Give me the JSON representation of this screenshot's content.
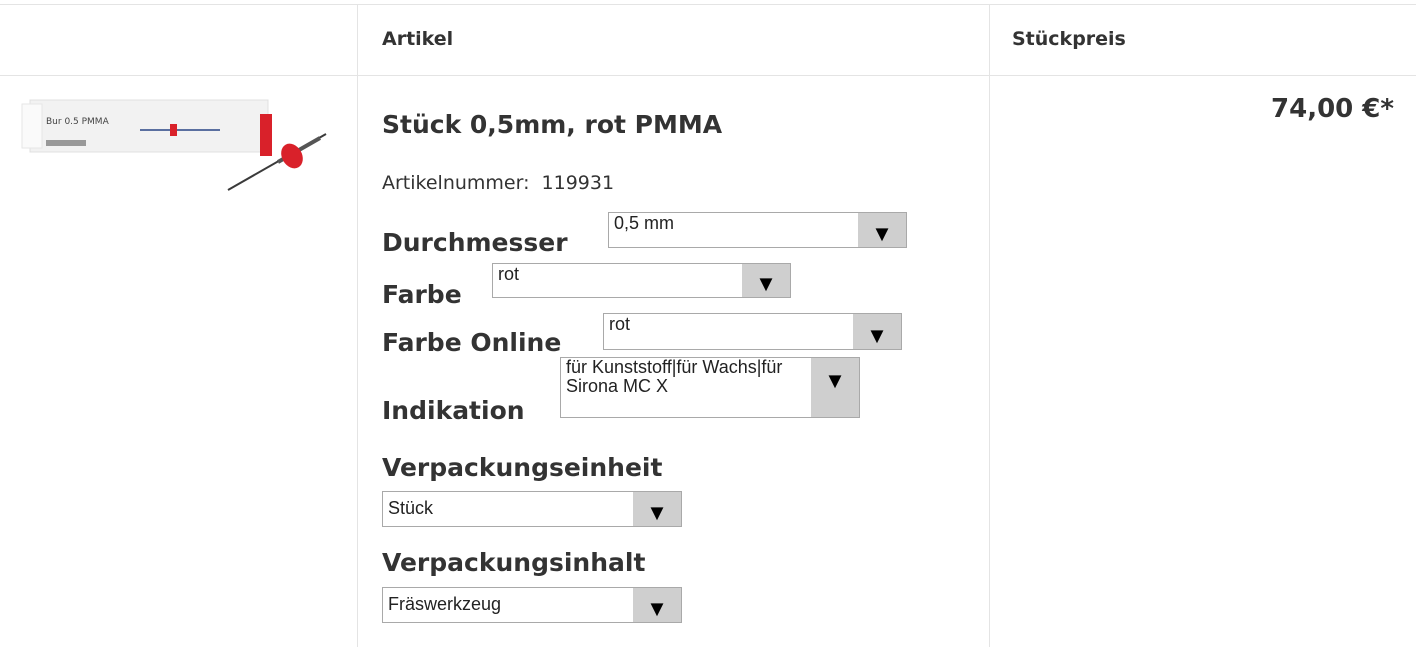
{
  "table": {
    "headers": {
      "artikel": "Artikel",
      "stueckpreis": "Stückpreis"
    }
  },
  "product": {
    "image_icon": "bur-package-image",
    "image_text": "Bur 0.5 PMMA",
    "title": "Stück 0,5mm, rot PMMA",
    "article_number_label": "Artikelnummer:",
    "article_number": "119931",
    "price": "74,00 €*"
  },
  "options": {
    "durchmesser": {
      "label": "Durchmesser",
      "value": "0,5 mm"
    },
    "farbe": {
      "label": "Farbe",
      "value": "rot"
    },
    "farbe_online": {
      "label": "Farbe Online",
      "value": "rot"
    },
    "indikation": {
      "label": "Indikation",
      "value": "für Kunststoff|für Wachs|für Sirona MC X"
    },
    "verpackungseinheit": {
      "label": "Verpackungseinheit",
      "value": "Stück"
    },
    "verpackungsinhalt": {
      "label": "Verpackungsinhalt",
      "value": "Fräswerkzeug"
    }
  },
  "icons": {
    "dropdown": "chevron-down-icon"
  },
  "colors": {
    "text": "#333333",
    "border": "#e4e4e4",
    "select_button": "#cfcfcf",
    "accent_red": "#d9212a"
  }
}
